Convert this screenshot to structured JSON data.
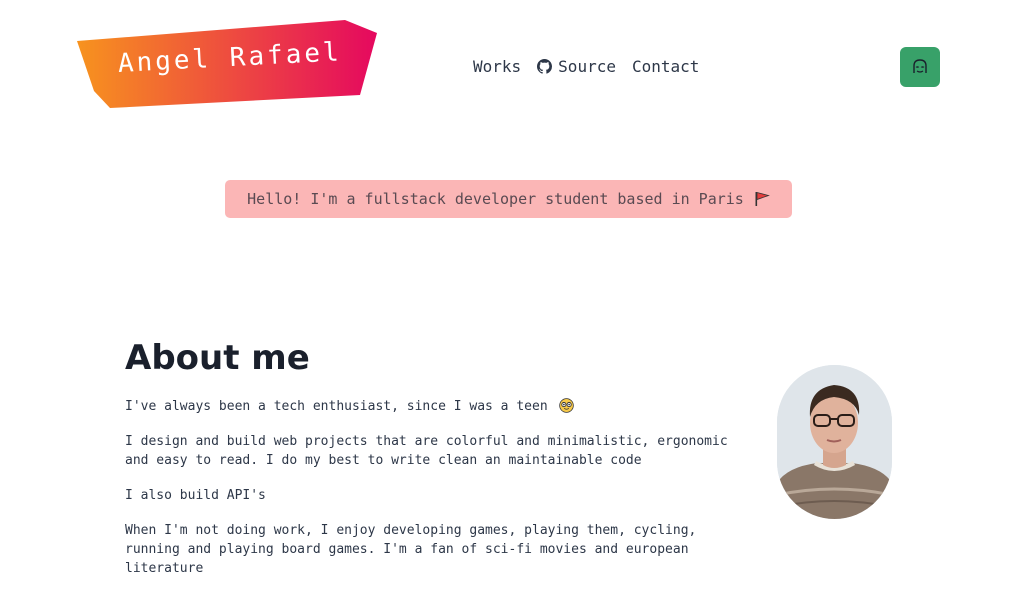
{
  "logo": {
    "name": "Angel Rafael",
    "gradient_start": "#f7931e",
    "gradient_end": "#e5085f"
  },
  "nav": {
    "items": [
      {
        "label": "Works"
      },
      {
        "label": "Source",
        "icon": "github-icon"
      },
      {
        "label": "Contact"
      }
    ],
    "theme_toggle": {
      "icon": "hacker-mask-icon",
      "color": "#38a169"
    }
  },
  "banner": {
    "text": "Hello! I'm a fullstack developer student based in Paris",
    "icon": "red-flag-icon",
    "color": "#fbb6b6"
  },
  "about": {
    "title": "About me",
    "paragraphs": [
      "I've always been a tech enthusiast, since I was a teen",
      "I design and build web projects that are colorful and minimalistic, ergonomic and easy to read. I do my best to write clean an maintainable code",
      "I also build API's",
      "When I'm not doing work, I enjoy developing games, playing them, cycling, running and playing board games. I'm a fan of sci-fi movies and european literature"
    ],
    "paragraph_1_emoji": "nerd-face-icon",
    "avatar": "profile-photo"
  }
}
